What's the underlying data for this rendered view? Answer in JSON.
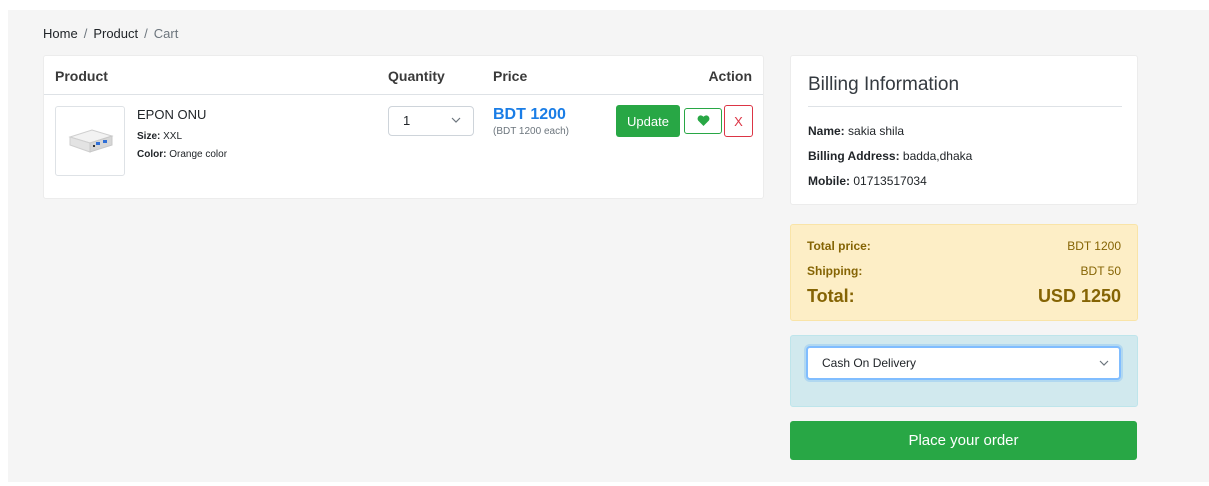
{
  "breadcrumb": {
    "items": [
      "Home",
      "Product",
      "Cart"
    ],
    "separator": "/"
  },
  "cart": {
    "columns": {
      "product": "Product",
      "quantity": "Quantity",
      "price": "Price",
      "action": "Action"
    },
    "items": [
      {
        "name": "EPON ONU",
        "size_label": "Size:",
        "size": "XXL",
        "color_label": "Color:",
        "color": "Orange color",
        "quantity": "1",
        "price": "BDT 1200",
        "price_each": "(BDT 1200 each)",
        "update_label": "Update",
        "wishlist_icon": "heart-icon",
        "remove_label": "X"
      }
    ]
  },
  "billing": {
    "title": "Billing Information",
    "name_label": "Name:",
    "name": "sakia shila",
    "address_label": "Billing Address:",
    "address": "badda,dhaka",
    "mobile_label": "Mobile:",
    "mobile": "01713517034"
  },
  "totals": {
    "total_price_label": "Total price:",
    "total_price": "BDT 1200",
    "shipping_label": "Shipping:",
    "shipping": "BDT 50",
    "total_label": "Total:",
    "total": "USD 1250"
  },
  "payment": {
    "selected": "Cash On Delivery"
  },
  "order_button": "Place your order",
  "colors": {
    "primary_green": "#28a745",
    "price_blue": "#1a7de6",
    "danger_red": "#dc3545",
    "totals_bg": "#fdeec6",
    "payment_bg": "#d1e9ee"
  }
}
